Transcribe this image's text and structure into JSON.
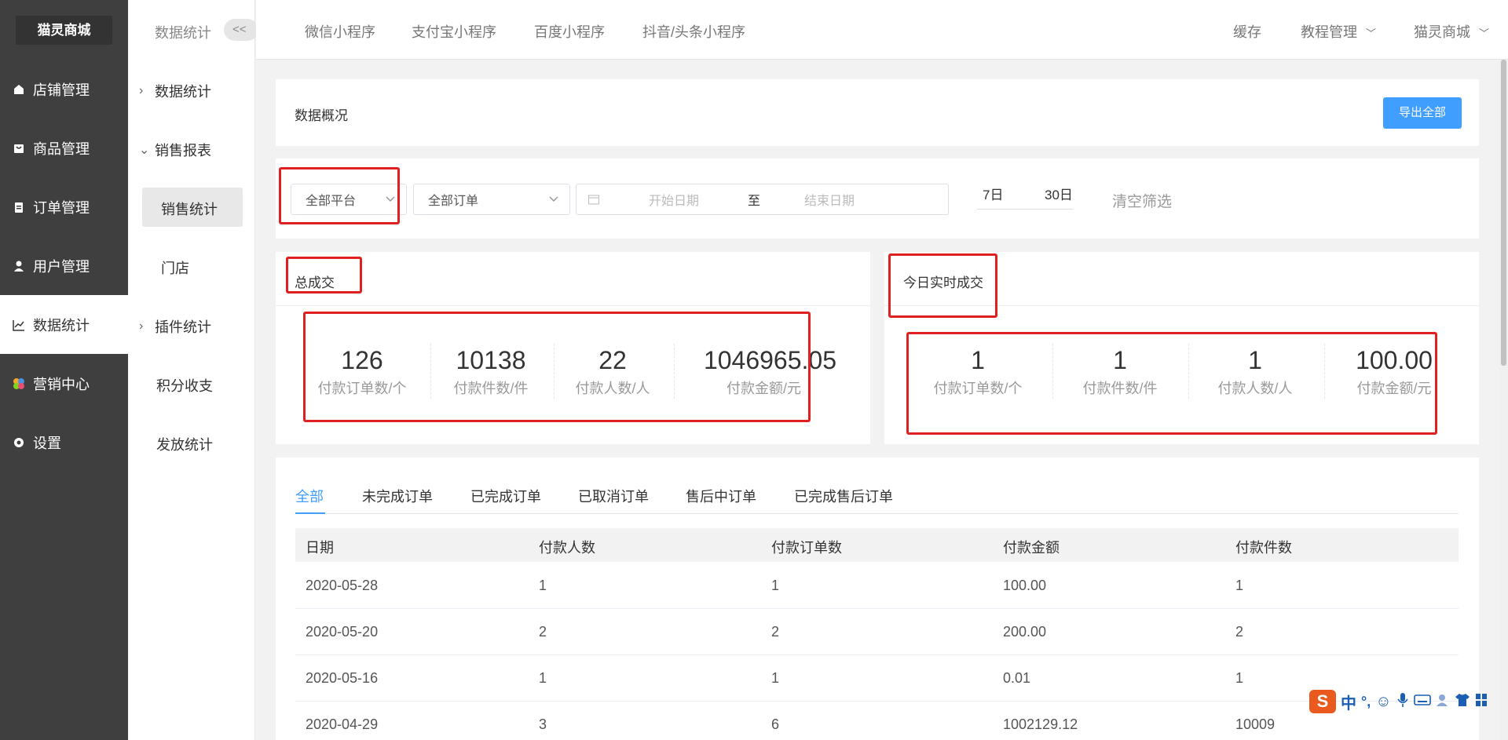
{
  "sidebar": {
    "logo": "猫灵商城",
    "items": [
      {
        "label": "店铺管理",
        "icon": "store-icon"
      },
      {
        "label": "商品管理",
        "icon": "bag-icon"
      },
      {
        "label": "订单管理",
        "icon": "clipboard-icon"
      },
      {
        "label": "用户管理",
        "icon": "user-icon"
      },
      {
        "label": "数据统计",
        "icon": "chart-icon",
        "active": true
      },
      {
        "label": "营销中心",
        "icon": "marketing-icon"
      },
      {
        "label": "设置",
        "icon": "gear-icon"
      }
    ]
  },
  "subbar": {
    "title": "数据统计",
    "collapse": "<<",
    "items": [
      "数据统计",
      "销售报表",
      "销售统计",
      "门店",
      "插件统计",
      "积分收支",
      "发放统计"
    ]
  },
  "topbar": {
    "tabs": [
      "微信小程序",
      "支付宝小程序",
      "百度小程序",
      "抖音/头条小程序"
    ],
    "cache": "缓存",
    "tutorial": "教程管理",
    "store": "猫灵商城"
  },
  "overview": {
    "title": "数据概况",
    "export_button": "导出全部"
  },
  "filters": {
    "platform": "全部平台",
    "order_type": "全部订单",
    "start_placeholder": "开始日期",
    "separator": "至",
    "end_placeholder": "结束日期",
    "quick_7": "7日",
    "quick_30": "30日",
    "clear": "清空筛选"
  },
  "total": {
    "title": "总成交",
    "stats": [
      {
        "value": "126",
        "label": "付款订单数/个"
      },
      {
        "value": "10138",
        "label": "付款件数/件"
      },
      {
        "value": "22",
        "label": "付款人数/人"
      },
      {
        "value": "1046965.05",
        "label": "付款金额/元"
      }
    ]
  },
  "today": {
    "title": "今日实时成交",
    "stats": [
      {
        "value": "1",
        "label": "付款订单数/个"
      },
      {
        "value": "1",
        "label": "付款件数/件"
      },
      {
        "value": "1",
        "label": "付款人数/人"
      },
      {
        "value": "100.00",
        "label": "付款金额/元"
      }
    ]
  },
  "tabs": [
    "全部",
    "未完成订单",
    "已完成订单",
    "已取消订单",
    "售后中订单",
    "已完成售后订单"
  ],
  "table": {
    "headers": [
      "日期",
      "付款人数",
      "付款订单数",
      "付款金额",
      "付款件数"
    ],
    "rows": [
      [
        "2020-05-28",
        "1",
        "1",
        "100.00",
        "1"
      ],
      [
        "2020-05-20",
        "2",
        "2",
        "200.00",
        "2"
      ],
      [
        "2020-05-16",
        "1",
        "1",
        "0.01",
        "1"
      ],
      [
        "2020-04-29",
        "3",
        "6",
        "1002129.12",
        "10009"
      ]
    ]
  },
  "ime": {
    "lang": "中",
    "punct": "°,"
  },
  "colors": {
    "accent": "#409eff",
    "sidebar": "#3f3f3f",
    "highlight": "#e02020"
  }
}
